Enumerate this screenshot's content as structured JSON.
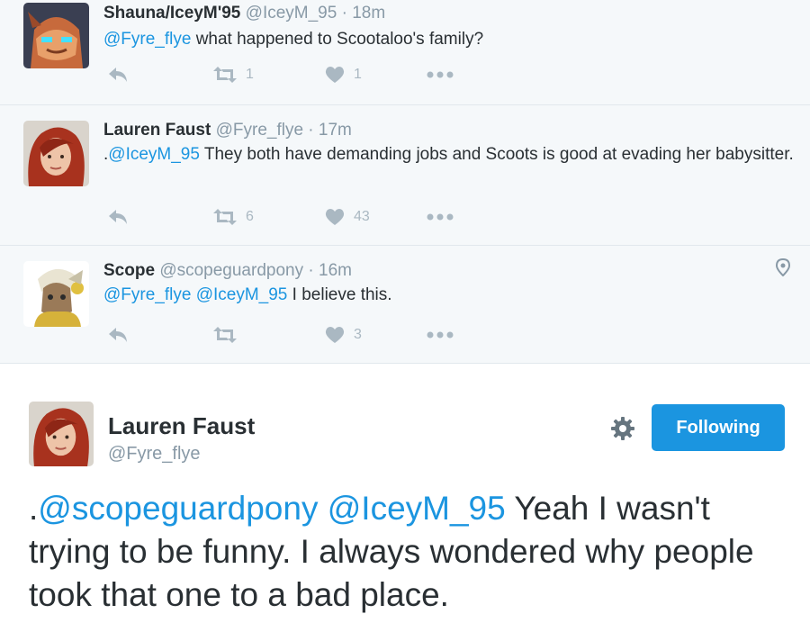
{
  "thread": [
    {
      "name": "Shauna/IceyM'95",
      "handle": "@IceyM_95",
      "time": "18m",
      "mentions": [
        "@Fyre_flye"
      ],
      "text": " what happened to Scootaloo's family?",
      "retweets": "1",
      "likes": "1"
    },
    {
      "name": "Lauren Faust",
      "handle": "@Fyre_flye",
      "time": "17m",
      "prefix": ".",
      "mentions": [
        "@IceyM_95"
      ],
      "text": " They both have demanding jobs and Scoots is good at evading her babysitter.",
      "retweets": "6",
      "likes": "43"
    },
    {
      "name": "Scope",
      "handle": "@scopeguardpony",
      "time": "16m",
      "mentions": [
        "@Fyre_flye",
        "@IceyM_95"
      ],
      "text": " I believe this.",
      "retweets": "",
      "likes": "3"
    }
  ],
  "separator": " · ",
  "main_tweet": {
    "name": "Lauren Faust",
    "handle": "@Fyre_flye",
    "follow_label": "Following",
    "prefix": ".",
    "mentions": [
      "@scopeguardpony",
      "@IceyM_95"
    ],
    "text": " Yeah I wasn't trying to be funny.  I always wondered why people took that one to a bad place."
  },
  "colors": {
    "accent": "#1b95e0",
    "muted": "#8899a6",
    "icon": "#aab8c2",
    "thread_bg": "#f5f8fa"
  },
  "icons": [
    "reply-icon",
    "retweet-icon",
    "heart-icon",
    "more-icon",
    "location-pin-icon",
    "gear-icon"
  ]
}
